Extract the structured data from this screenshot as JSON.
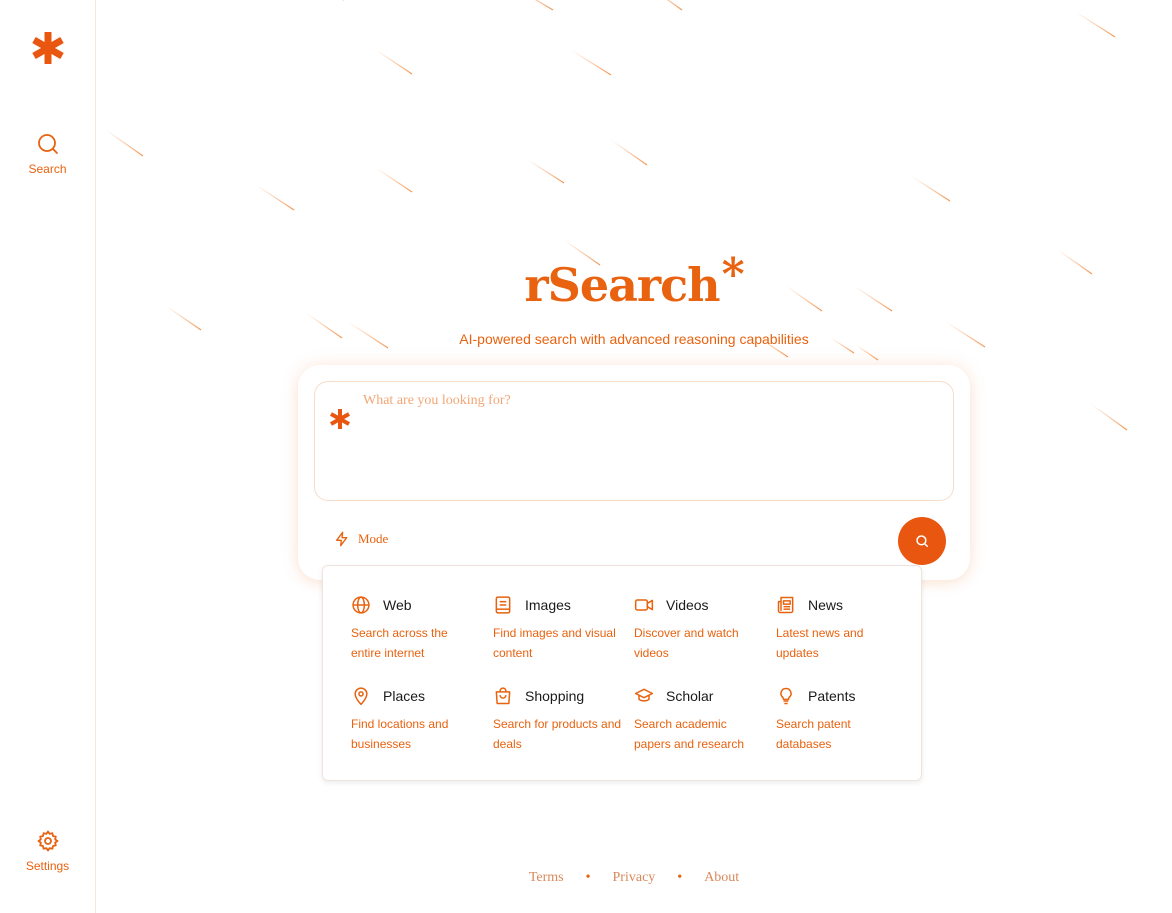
{
  "sidebar": {
    "logo_icon": "asterisk-logo",
    "items": [
      {
        "label": "Search",
        "icon": "search-icon"
      },
      {
        "label": "Settings",
        "icon": "gear-icon"
      }
    ]
  },
  "hero": {
    "brand": "rSearch",
    "brand_suffix": "*",
    "tagline": "AI-powered search with advanced reasoning capabilities"
  },
  "search": {
    "placeholder": "What are you looking for?",
    "mode_label": "Mode",
    "submit_icon": "search-icon"
  },
  "modes": [
    {
      "title": "Web",
      "desc": "Search across the entire internet",
      "icon": "globe-icon"
    },
    {
      "title": "Images",
      "desc": "Find images and visual content",
      "icon": "book-icon"
    },
    {
      "title": "Videos",
      "desc": "Discover and watch videos",
      "icon": "video-icon"
    },
    {
      "title": "News",
      "desc": "Latest news and updates",
      "icon": "newspaper-icon"
    },
    {
      "title": "Places",
      "desc": "Find locations and businesses",
      "icon": "map-pin-icon"
    },
    {
      "title": "Shopping",
      "desc": "Search for products and deals",
      "icon": "shopping-bag-icon"
    },
    {
      "title": "Scholar",
      "desc": "Search academic papers and research",
      "icon": "graduation-cap-icon"
    },
    {
      "title": "Patents",
      "desc": "Search patent databases",
      "icon": "lightbulb-icon"
    }
  ],
  "footer": {
    "links": [
      "Terms",
      "Privacy",
      "About"
    ],
    "separator": "•"
  },
  "colors": {
    "accent": "#e8620f",
    "button": "#e8560f"
  }
}
